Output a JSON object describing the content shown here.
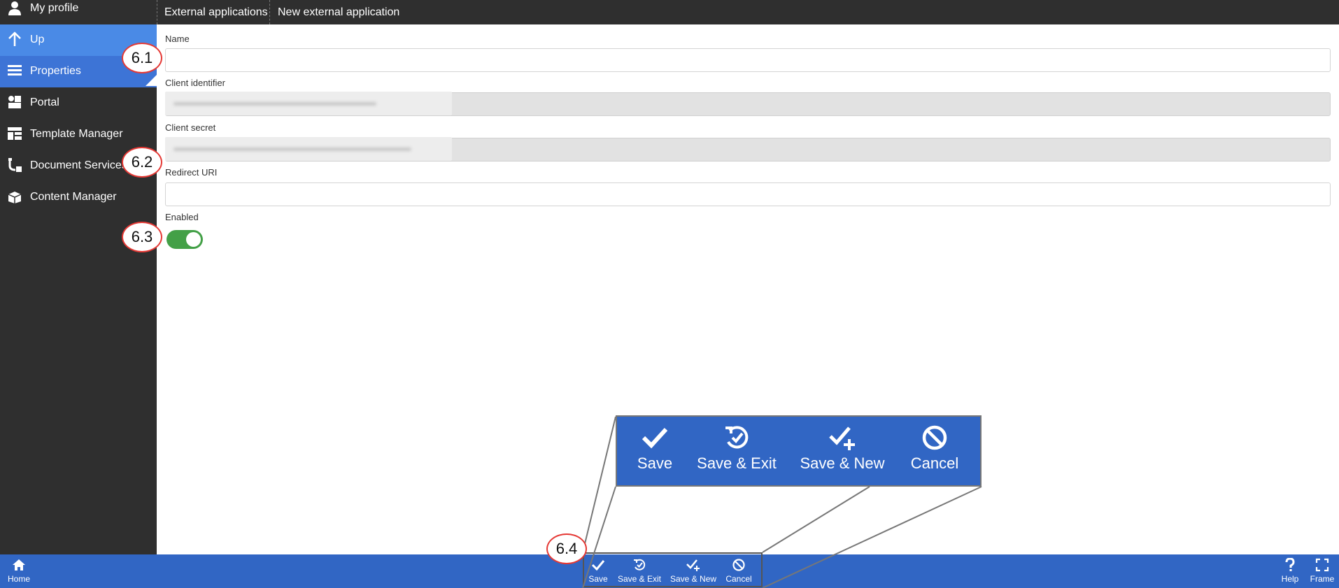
{
  "sidebar": {
    "items": [
      {
        "label": "My profile",
        "icon": "user-icon"
      },
      {
        "label": "Up",
        "icon": "arrow-up-icon"
      },
      {
        "label": "Properties",
        "icon": "list-icon"
      },
      {
        "label": "Portal",
        "icon": "portal-icon"
      },
      {
        "label": "Template Manager",
        "icon": "template-icon"
      },
      {
        "label": "Document Services",
        "icon": "document-services-icon"
      },
      {
        "label": "Content Manager",
        "icon": "content-manager-icon"
      }
    ]
  },
  "breadcrumb": {
    "items": [
      "External applications",
      "New external application"
    ]
  },
  "form": {
    "name_label": "Name",
    "name_value": "",
    "client_id_label": "Client identifier",
    "client_secret_label": "Client secret",
    "redirect_label": "Redirect URI",
    "redirect_value": "",
    "enabled_label": "Enabled",
    "enabled": true
  },
  "annotations": [
    "6.1",
    "6.2",
    "6.3",
    "6.4"
  ],
  "bottombar": {
    "home_label": "Home",
    "save_label": "Save",
    "save_exit_label": "Save & Exit",
    "save_new_label": "Save & New",
    "cancel_label": "Cancel",
    "help_label": "Help",
    "frame_label": "Frame"
  },
  "colors": {
    "sidebar_bg": "#2f2f2f",
    "accent_blue": "#3166c4",
    "active_item": "#3d74d6",
    "toggle_on": "#43a047",
    "annotation_red": "#e53935"
  }
}
